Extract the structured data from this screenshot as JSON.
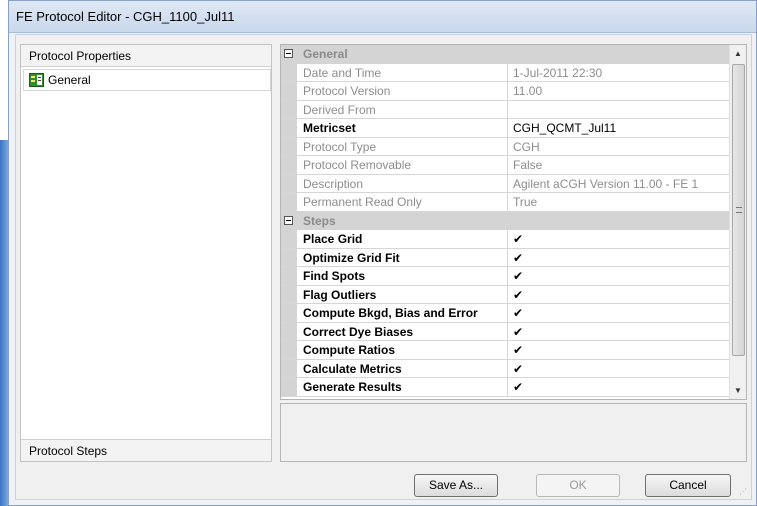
{
  "window": {
    "title": "FE Protocol Editor - CGH_1100_Jul11"
  },
  "left_panel": {
    "header": "Protocol Properties",
    "items": [
      {
        "label": "General",
        "icon": "general-properties-icon"
      }
    ],
    "footer": "Protocol Steps"
  },
  "grid": {
    "categories": [
      {
        "name": "General",
        "rows": [
          {
            "name": "Date and Time",
            "value": "1-Jul-2011 22:30",
            "readonly": true
          },
          {
            "name": "Protocol Version",
            "value": "11.00",
            "readonly": true
          },
          {
            "name": "Derived From",
            "value": "",
            "readonly": true
          },
          {
            "name": "Metricset",
            "value": "CGH_QCMT_Jul11",
            "readonly": false
          },
          {
            "name": "Protocol Type",
            "value": "CGH",
            "readonly": true
          },
          {
            "name": "Protocol Removable",
            "value": "False",
            "readonly": true
          },
          {
            "name": "Description",
            "value": "Agilent aCGH Version 11.00 - FE 1",
            "readonly": true
          },
          {
            "name": "Permanent Read Only",
            "value": "True",
            "readonly": true
          }
        ]
      },
      {
        "name": "Steps",
        "rows": [
          {
            "name": "Place Grid",
            "value": "✔"
          },
          {
            "name": "Optimize Grid Fit",
            "value": "✔"
          },
          {
            "name": "Find Spots",
            "value": "✔"
          },
          {
            "name": "Flag Outliers",
            "value": "✔"
          },
          {
            "name": "Compute Bkgd, Bias and Error",
            "value": "✔"
          },
          {
            "name": "Correct Dye Biases",
            "value": "✔"
          },
          {
            "name": "Compute Ratios",
            "value": "✔"
          },
          {
            "name": "Calculate Metrics",
            "value": "✔"
          },
          {
            "name": "Generate Results",
            "value": "✔"
          }
        ]
      }
    ],
    "scroll_up_glyph": "▲",
    "scroll_down_glyph": "▼"
  },
  "buttons": {
    "save_as": "Save As...",
    "ok": "OK",
    "cancel": "Cancel"
  }
}
